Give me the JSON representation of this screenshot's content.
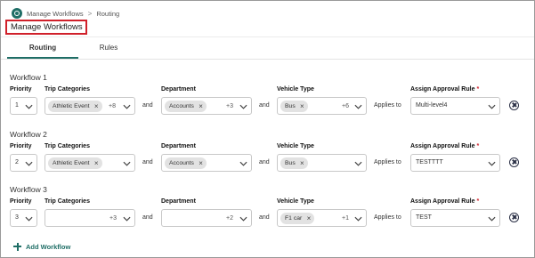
{
  "breadcrumb": {
    "home": "Manage Workflows",
    "separator": ">",
    "current": "Routing"
  },
  "page_title": "Manage Workflows",
  "tabs": [
    {
      "label": "Routing",
      "active": true
    },
    {
      "label": "Rules",
      "active": false
    }
  ],
  "labels": {
    "priority": "Priority",
    "trip_categories": "Trip Categories",
    "department": "Department",
    "vehicle_type": "Vehicle Type",
    "assign_rule": "Assign Approval Rule",
    "required_mark": "*",
    "and": "and",
    "applies_to": "Applies to"
  },
  "workflows": [
    {
      "title": "Workflow 1",
      "priority": "1",
      "trip_category_chip": "Athletic Event",
      "trip_more": "+8",
      "department_chip": "Accounts",
      "department_more": "+3",
      "vehicle_chip": "Bus",
      "vehicle_more": "+6",
      "approval_rule": "Multi-level4"
    },
    {
      "title": "Workflow 2",
      "priority": "2",
      "trip_category_chip": "Athletic Event",
      "trip_more": "",
      "department_chip": "Accounts",
      "department_more": "",
      "vehicle_chip": "Bus",
      "vehicle_more": "",
      "approval_rule": "TESTTTT"
    },
    {
      "title": "Workflow 3",
      "priority": "3",
      "trip_category_chip": "",
      "trip_more": "+3",
      "department_chip": "",
      "department_more": "+2",
      "vehicle_chip": "F1 car",
      "vehicle_more": "+1",
      "approval_rule": "TEST"
    }
  ],
  "add_workflow_label": "Add Workflow",
  "icons": {
    "chip_remove": "×",
    "chevron": "chevron-down-icon",
    "remove_workflow": "close-circle-icon",
    "add": "plus-icon"
  },
  "colors": {
    "accent": "#1f6e66",
    "highlight_border": "#d0202a",
    "required": "#d0202a"
  }
}
